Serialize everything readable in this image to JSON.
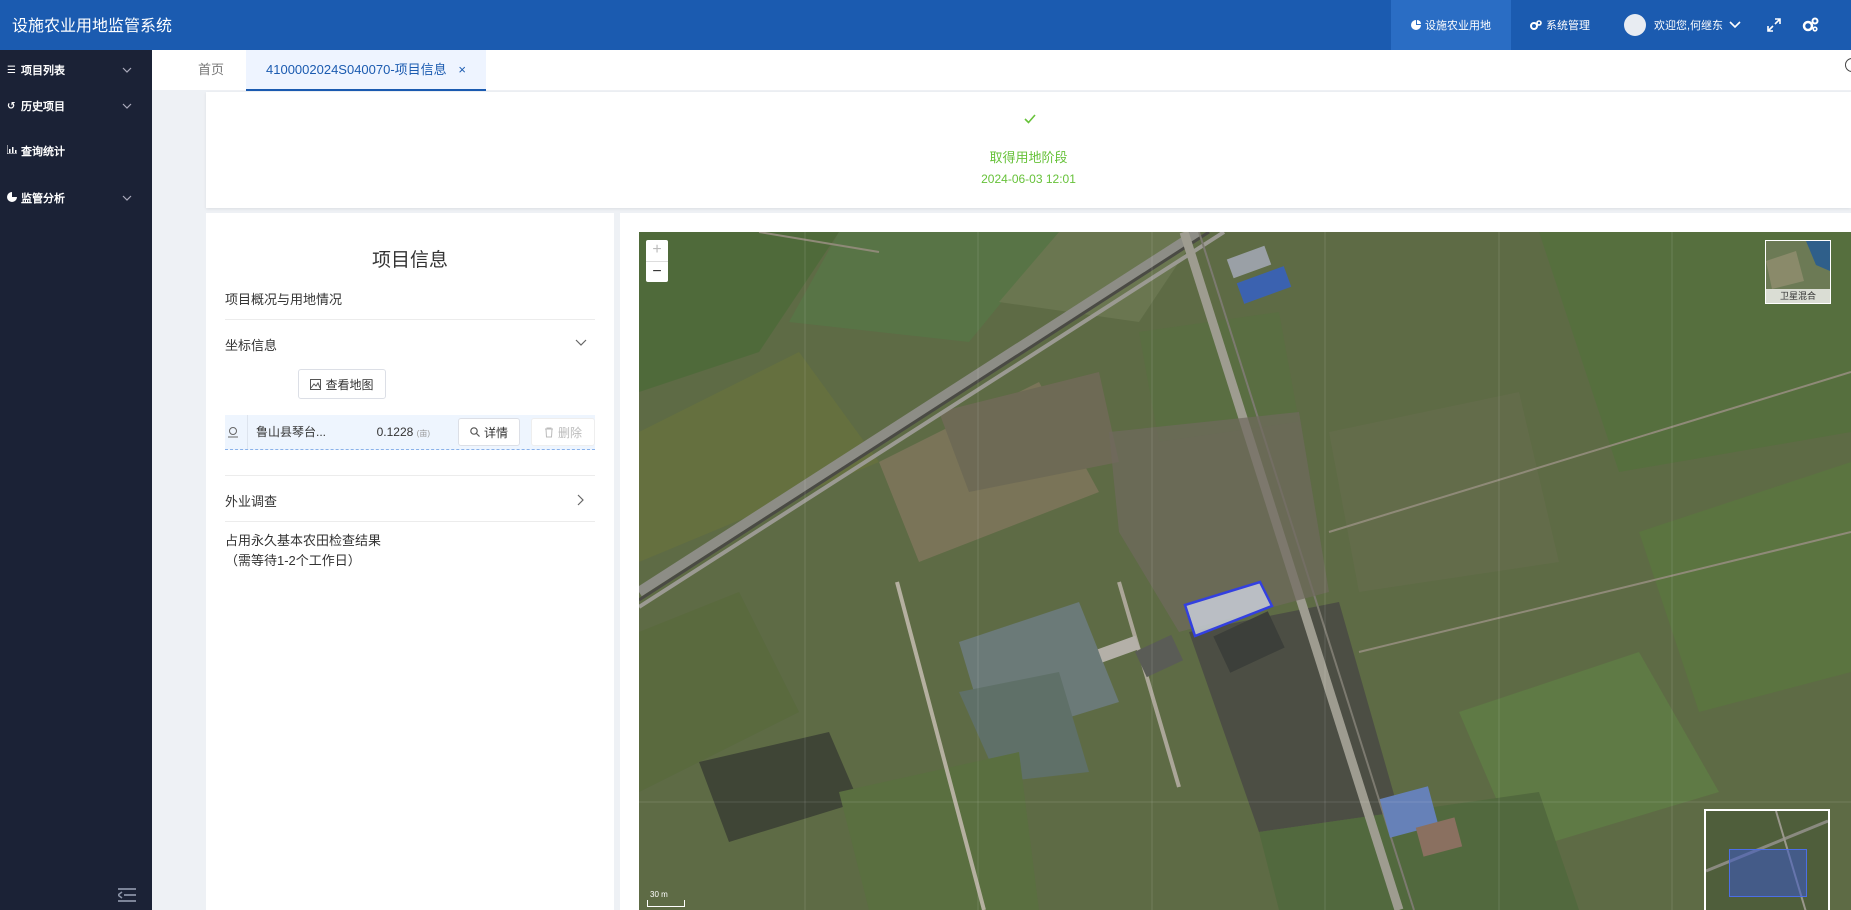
{
  "header": {
    "title": "设施农业用地监管系统",
    "nav": [
      {
        "label": "设施农业用地",
        "icon": "pie-chart-icon",
        "active": true
      },
      {
        "label": "系统管理",
        "icon": "cogs-icon",
        "active": false
      }
    ],
    "user_greeting": "欢迎您,何继东"
  },
  "sidebar": {
    "items": [
      {
        "label": "项目列表",
        "icon": "list-icon",
        "expandable": true
      },
      {
        "label": "历史项目",
        "icon": "history-icon",
        "expandable": true
      },
      {
        "label": "查询统计",
        "icon": "bar-chart-icon",
        "expandable": false
      },
      {
        "label": "监管分析",
        "icon": "pie-chart-icon",
        "expandable": true
      }
    ]
  },
  "tabs": [
    {
      "label": "首页",
      "active": false
    },
    {
      "label": "4100002024S040070-项目信息",
      "active": true,
      "closable": true
    }
  ],
  "status": {
    "label": "取得用地阶段",
    "time": "2024-06-03 12:01",
    "color": "#67c23a"
  },
  "info": {
    "title": "项目信息",
    "sections": {
      "overview": "项目概况与用地情况",
      "coordinates": "坐标信息",
      "field_survey": "外业调查",
      "farmland_check": "占用永久基本农田检查结果",
      "farmland_note": "（需等待1-2个工作日）"
    },
    "view_map_label": "查看地图",
    "coord_row": {
      "location": "鲁山县琴台...",
      "area": "0.1228",
      "unit": "(亩)",
      "detail_label": "详情",
      "delete_label": "删除"
    }
  },
  "map": {
    "basemap_label": "卫星混合",
    "zoom_in": "+",
    "zoom_out": "−",
    "scale_label": "30 m"
  },
  "colors": {
    "header_bg": "#1b5bb0",
    "sidebar_bg": "#1b2236",
    "accent": "#1b5bb0",
    "success": "#67c23a"
  }
}
